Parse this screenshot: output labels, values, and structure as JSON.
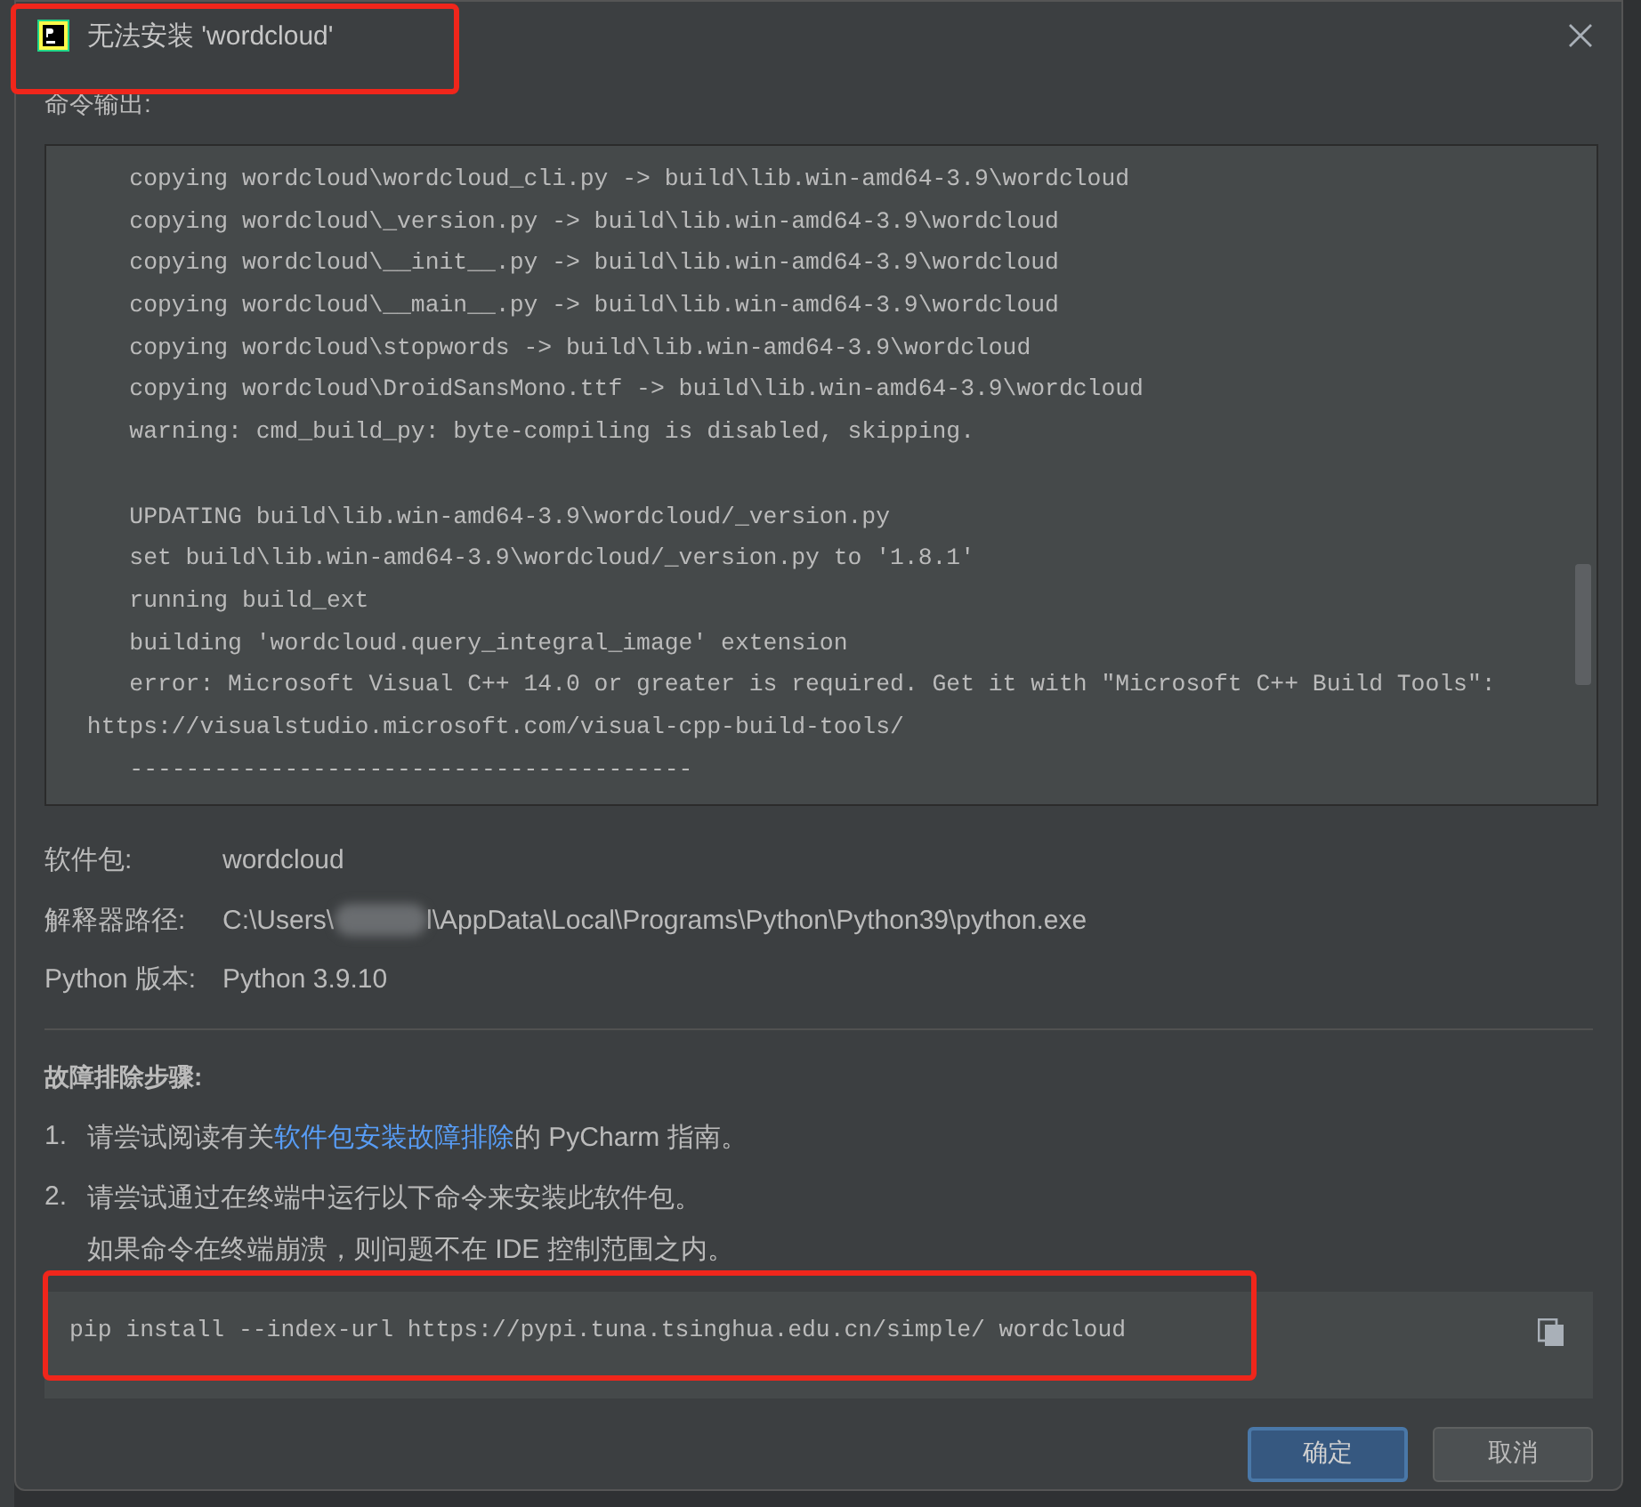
{
  "window": {
    "title": "无法安装 'wordcloud'"
  },
  "output": {
    "label": "命令输出:",
    "lines": [
      {
        "kind": "text",
        "text": "    copying wordcloud\\wordcloud_cli.py -> build\\lib.win-amd64-3.9\\wordcloud"
      },
      {
        "kind": "text",
        "text": "    copying wordcloud\\_version.py -> build\\lib.win-amd64-3.9\\wordcloud"
      },
      {
        "kind": "text",
        "text": "    copying wordcloud\\__init__.py -> build\\lib.win-amd64-3.9\\wordcloud"
      },
      {
        "kind": "text",
        "text": "    copying wordcloud\\__main__.py -> build\\lib.win-amd64-3.9\\wordcloud"
      },
      {
        "kind": "text",
        "text": "    copying wordcloud\\stopwords -> build\\lib.win-amd64-3.9\\wordcloud"
      },
      {
        "kind": "text",
        "text": "    copying wordcloud\\DroidSansMono.ttf -> build\\lib.win-amd64-3.9\\wordcloud"
      },
      {
        "kind": "text",
        "text": "    warning: cmd_build_py: byte-compiling is disabled, skipping."
      },
      {
        "kind": "blank"
      },
      {
        "kind": "text",
        "text": "    UPDATING build\\lib.win-amd64-3.9\\wordcloud/_version.py"
      },
      {
        "kind": "text",
        "text": "    set build\\lib.win-amd64-3.9\\wordcloud/_version.py to '1.8.1'"
      },
      {
        "kind": "text",
        "text": "    running build_ext"
      },
      {
        "kind": "text",
        "text": "    building 'wordcloud.query_integral_image' extension"
      },
      {
        "kind": "text",
        "text": "    error: Microsoft Visual C++ 14.0 or greater is required. Get it with \"Microsoft C++ Build Tools\":"
      },
      {
        "kind": "text",
        "text": " https://visualstudio.microsoft.com/visual-cpp-build-tools/"
      },
      {
        "kind": "text",
        "text": "    ----------------------------------------"
      }
    ]
  },
  "details": [
    {
      "label": "软件包:",
      "value": "wordcloud"
    },
    {
      "label": "解释器路径:",
      "value": "C:\\Users\\",
      "redacted": true,
      "value_after": "l\\AppData\\Local\\Programs\\Python\\Python39\\python.exe"
    },
    {
      "label": "Python 版本:",
      "value": "Python 3.9.10"
    }
  ],
  "troubleshooting": {
    "heading": "故障排除步骤:",
    "steps": [
      {
        "number": "1.",
        "before": "请尝试阅读有关",
        "link": "软件包安装故障排除",
        "after": "的 PyCharm 指南。"
      },
      {
        "number": "2.",
        "before": "请尝试通过在终端中运行以下命令来安装此软件包。"
      }
    ],
    "note": "如果命令在终端崩溃，则问题不在 IDE 控制范围之内。",
    "command": "pip install --index-url https://pypi.tuna.tsinghua.edu.cn/simple/ wordcloud"
  },
  "buttons": [
    {
      "label": "确定",
      "primary": true
    },
    {
      "label": "取消",
      "primary": false
    }
  ]
}
